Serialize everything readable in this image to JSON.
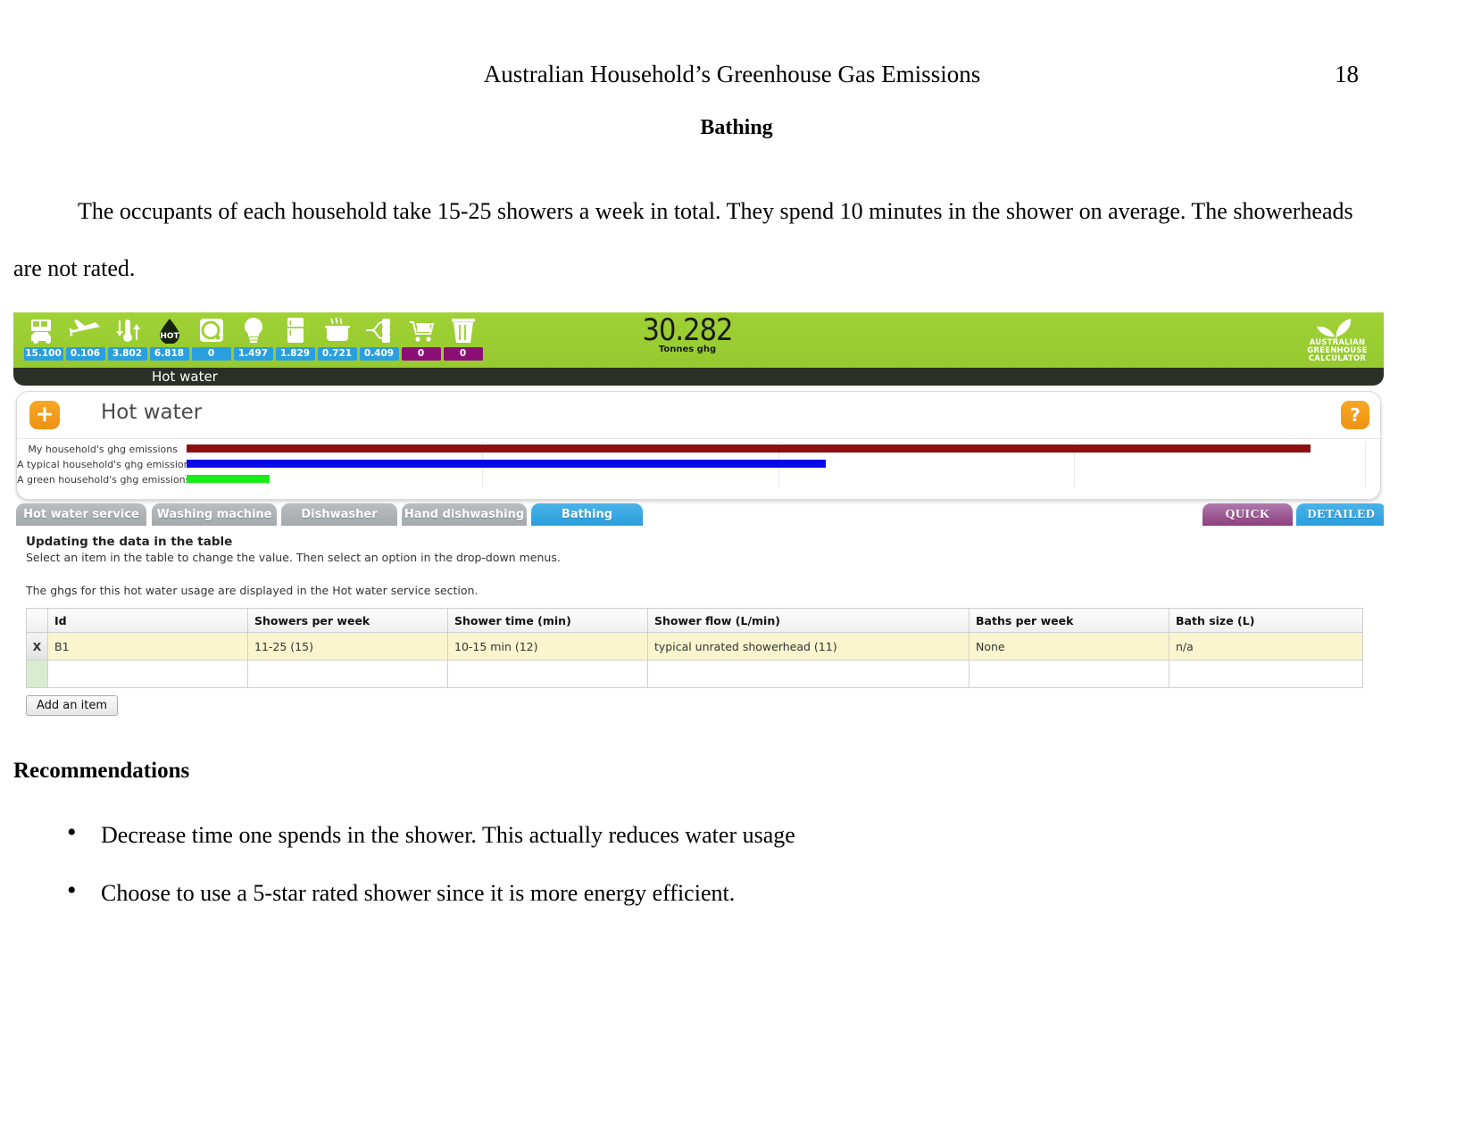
{
  "document": {
    "header_title": "Australian Household’s Greenhouse Gas Emissions",
    "page_number": "18",
    "section_title": "Bathing",
    "paragraph": "The occupants of each household take 15-25 showers a week in total. They spend 10 minutes in the shower on average. The showerheads are not rated.",
    "recommendations_title": "Recommendations",
    "recommendations": [
      "Decrease  time one spends in the shower. This actually reduces water usage",
      "Choose to use a 5-star rated shower since it is more energy efficient."
    ]
  },
  "calculator": {
    "total_value": "30.282",
    "total_unit": "Tonnes ghg",
    "brand": {
      "line1": "AUSTRALIAN",
      "line2": "GREENHOUSE",
      "line3": "CALCULATOR",
      "icon": "leaf-icon"
    },
    "breadcrumb": "Hot water",
    "icon_strip": [
      {
        "icon": "car-bus-icon",
        "value": "15.100",
        "color": "#2a9fe0"
      },
      {
        "icon": "airplane-icon",
        "value": "0.106",
        "color": "#2a9fe0"
      },
      {
        "icon": "thermometer-icon",
        "value": "3.802",
        "color": "#2a9fe0"
      },
      {
        "icon": "hot-water-drop-icon",
        "value": "6.818",
        "color": "#2a9fe0"
      },
      {
        "icon": "washing-machine-icon",
        "value": "0",
        "color": "#2a9fe0"
      },
      {
        "icon": "light-bulb-icon",
        "value": "1.497",
        "color": "#2a9fe0"
      },
      {
        "icon": "fridge-icon",
        "value": "1.829",
        "color": "#2a9fe0"
      },
      {
        "icon": "cooking-pot-icon",
        "value": "0.721",
        "color": "#2a9fe0"
      },
      {
        "icon": "appliances-plug-icon",
        "value": "0.409",
        "color": "#2a9fe0"
      },
      {
        "icon": "shopping-trolley-icon",
        "value": "0",
        "color": "#8c0f78"
      },
      {
        "icon": "waste-bin-icon",
        "value": "0",
        "color": "#8c0f78"
      }
    ],
    "panel": {
      "title": "Hot water",
      "add_label": "+",
      "help_label": "?"
    },
    "chart_data": {
      "type": "bar",
      "orientation": "horizontal",
      "title": "",
      "categories": [
        "My household's ghg emissions",
        "A typical household's ghg emissions",
        "A green household's ghg emissions"
      ],
      "values": [
        95,
        54,
        7
      ],
      "colors": [
        "#8c1010",
        "#0a0ae8",
        "#16ec16"
      ],
      "xlabel": "",
      "ylabel": "",
      "xlim": [
        0,
        100
      ],
      "grid": true,
      "gridline_positions": [
        25,
        50,
        75,
        100
      ],
      "legend": "none"
    },
    "tabs": [
      {
        "label": "Hot water service",
        "active": false
      },
      {
        "label": "Washing machine",
        "active": false
      },
      {
        "label": "Dishwasher",
        "active": false
      },
      {
        "label": "Hand dishwashing",
        "active": false
      },
      {
        "label": "Bathing",
        "active": true
      }
    ],
    "mode_tabs": [
      {
        "label": "QUICK",
        "active": false
      },
      {
        "label": "DETAILED",
        "active": true
      }
    ],
    "instructions": {
      "heading": "Updating the data in the table",
      "subtext": "Select an item in the table to change the value. Then select an option in the drop-down menus.",
      "note": "The ghgs for this hot water usage are displayed in the Hot water service section."
    },
    "table": {
      "columns": [
        "",
        "Id",
        "Showers per week",
        "Shower time (min)",
        "Shower flow (L/min)",
        "Baths per week",
        "Bath size (L)"
      ],
      "rows": [
        {
          "delete_label": "X",
          "cells": [
            "B1",
            "11-25 (15)",
            "10-15 min (12)",
            "typical unrated showerhead (11)",
            "None",
            "n/a"
          ]
        }
      ],
      "add_item_label": "Add an item"
    }
  }
}
